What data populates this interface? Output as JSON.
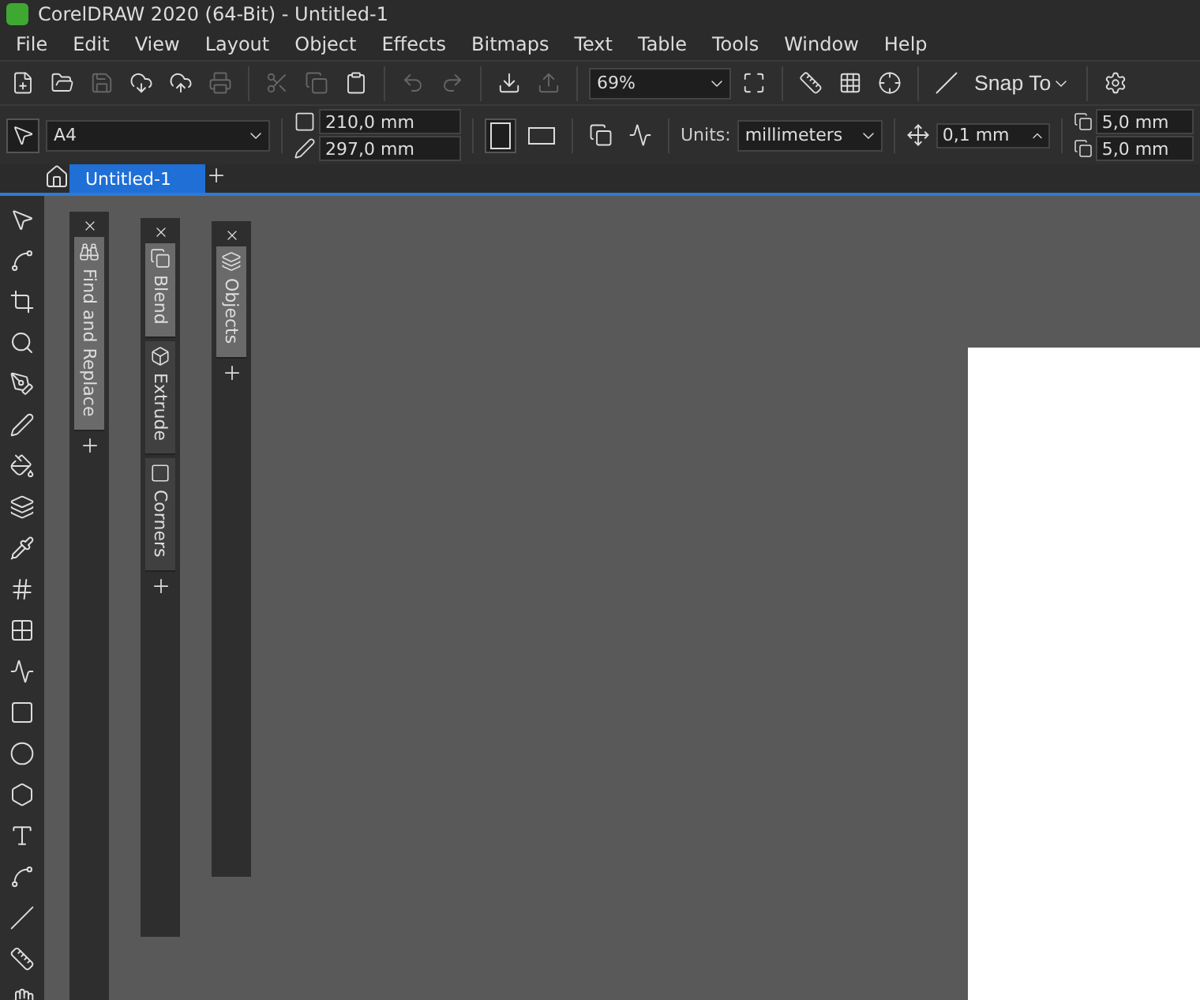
{
  "window": {
    "title": "CorelDRAW 2020 (64-Bit) - Untitled-1"
  },
  "menu": [
    "File",
    "Edit",
    "View",
    "Layout",
    "Object",
    "Effects",
    "Bitmaps",
    "Text",
    "Table",
    "Tools",
    "Window",
    "Help"
  ],
  "toolbar": {
    "zoom": "69%",
    "snap": "Snap To"
  },
  "property_bar": {
    "page_size": "A4",
    "width": "210,0 mm",
    "height": "297,0 mm",
    "orientation": [
      {
        "kind": "portrait",
        "selected": true
      },
      {
        "kind": "landscape",
        "selected": false
      }
    ],
    "units_label": "Units:",
    "units": "millimeters",
    "nudge": "0,1 mm",
    "duplicate_x": "5,0 mm",
    "duplicate_y": "5,0 mm"
  },
  "document_tabs": [
    {
      "label": "Untitled-1",
      "selected": true
    }
  ],
  "dockers": [
    {
      "tabs": [
        {
          "label": "Find and Replace",
          "kind": "find",
          "selected": true
        }
      ]
    },
    {
      "tabs": [
        {
          "label": "Blend",
          "kind": "blend",
          "selected": true
        },
        {
          "label": "Extrude",
          "kind": "extrude",
          "selected": false
        },
        {
          "label": "Corners",
          "kind": "corners",
          "selected": false
        }
      ]
    },
    {
      "tabs": [
        {
          "label": "Objects",
          "kind": "objects",
          "selected": true
        }
      ]
    }
  ]
}
